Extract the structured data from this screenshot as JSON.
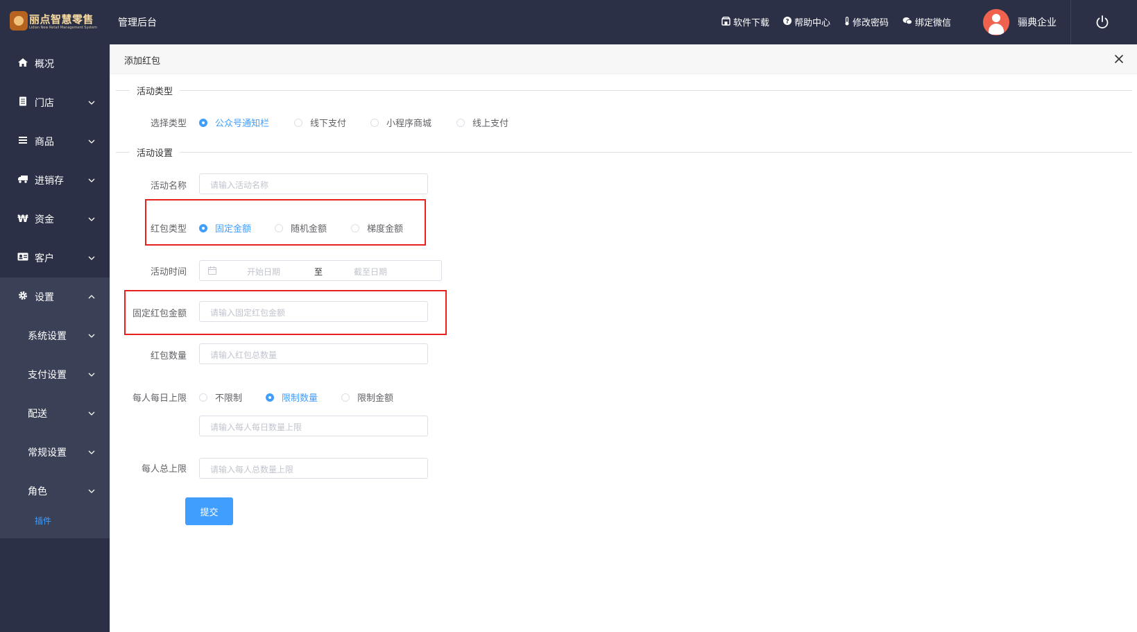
{
  "header": {
    "logo_text": "丽点智慧零售",
    "logo_subtext": "Lidian New Retail Management System",
    "app_title": "管理后台",
    "links": [
      {
        "label": "软件下载",
        "icon": "store-icon"
      },
      {
        "label": "帮助中心",
        "icon": "help-icon"
      },
      {
        "label": "修改密码",
        "icon": "thermometer-icon"
      },
      {
        "label": "绑定微信",
        "icon": "wechat-icon"
      }
    ],
    "user_name": "骊典企业"
  },
  "sidebar": {
    "items": [
      {
        "label": "概况",
        "icon": "home-icon"
      },
      {
        "label": "门店",
        "icon": "store-doc-icon"
      },
      {
        "label": "商品",
        "icon": "list-icon"
      },
      {
        "label": "进销存",
        "icon": "truck-icon"
      },
      {
        "label": "资金",
        "icon": "currency-icon"
      },
      {
        "label": "客户",
        "icon": "id-card-icon"
      },
      {
        "label": "设置",
        "icon": "gear-icon"
      }
    ],
    "settings_sub": [
      {
        "label": "系统设置"
      },
      {
        "label": "支付设置"
      },
      {
        "label": "配送"
      },
      {
        "label": "常规设置"
      },
      {
        "label": "角色"
      }
    ],
    "plugin_label": "插件"
  },
  "panel": {
    "title": "添加红包",
    "section_type": "活动类型",
    "select_type_label": "选择类型",
    "type_options": [
      "公众号通知栏",
      "线下支付",
      "小程序商城",
      "线上支付"
    ],
    "type_selected": "公众号通知栏",
    "section_settings": "活动设置",
    "name_label": "活动名称",
    "name_placeholder": "请输入活动名称",
    "rp_type_label": "红包类型",
    "rp_type_options": [
      "固定金额",
      "随机金额",
      "梯度金额"
    ],
    "rp_type_selected": "固定金额",
    "time_label": "活动时间",
    "start_placeholder": "开始日期",
    "range_sep": "至",
    "end_placeholder": "截至日期",
    "fixed_amount_label": "固定红包金额",
    "fixed_amount_placeholder": "请输入固定红包金额",
    "count_label": "红包数量",
    "count_placeholder": "请输入红包总数量",
    "daily_limit_label": "每人每日上限",
    "daily_limit_options": [
      "不限制",
      "限制数量",
      "限制金额"
    ],
    "daily_limit_selected": "限制数量",
    "daily_limit_placeholder": "请输入每人每日数量上限",
    "total_limit_label": "每人总上限",
    "total_limit_placeholder": "请输入每人总数量上限",
    "submit_label": "提交"
  },
  "colors": {
    "primary": "#409eff",
    "sidebar_bg": "#2b3046",
    "highlight": "#e8201e"
  }
}
